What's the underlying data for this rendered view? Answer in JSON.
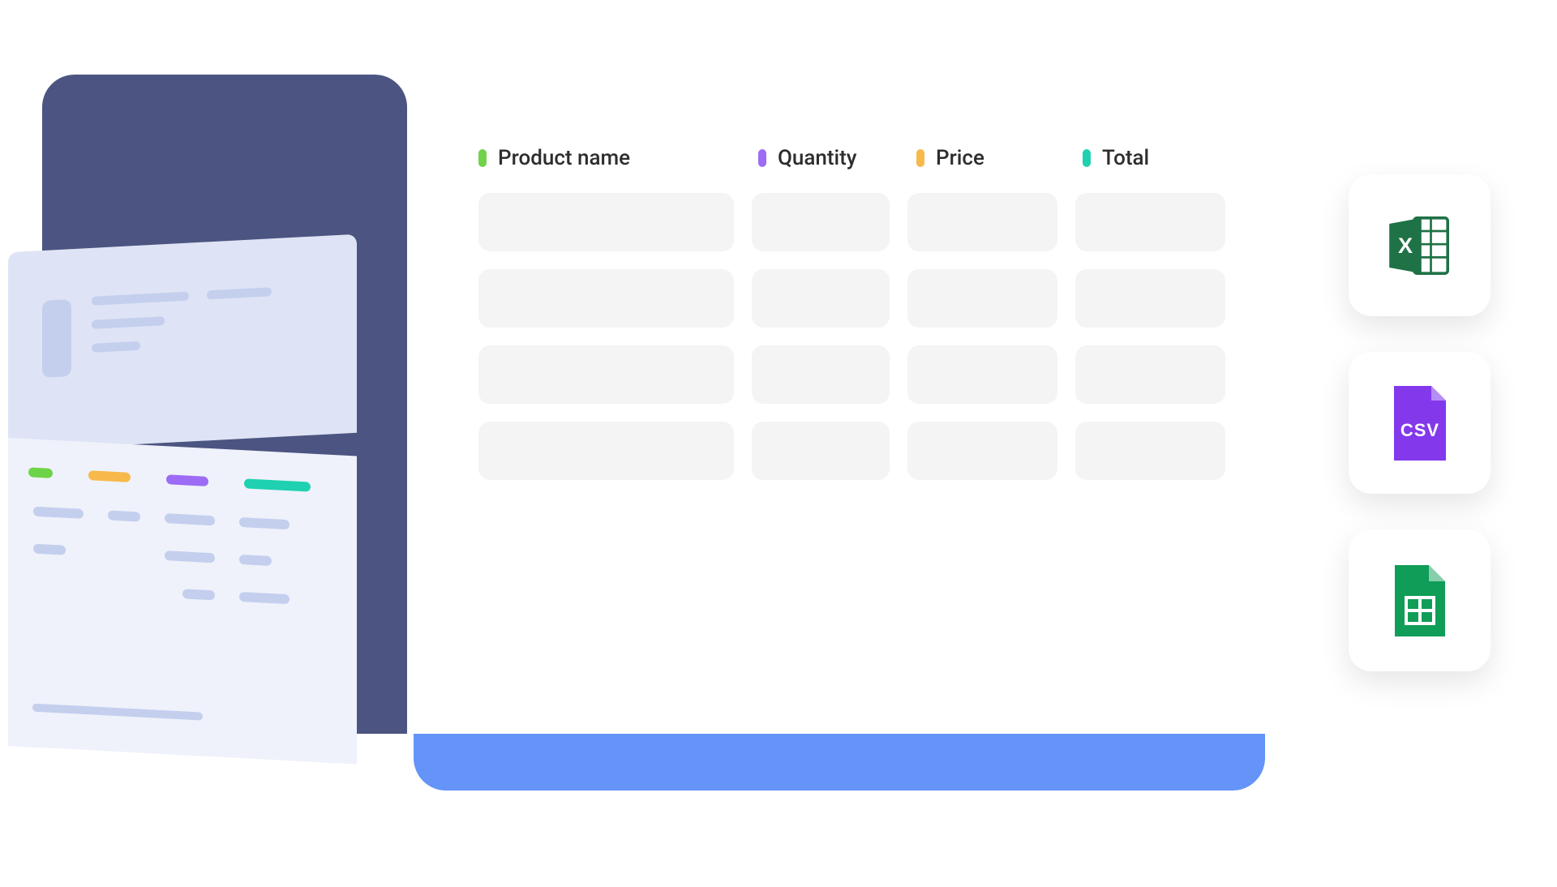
{
  "table": {
    "columns": [
      {
        "label": "Product name",
        "color": "green"
      },
      {
        "label": "Quantity",
        "color": "purple"
      },
      {
        "label": "Price",
        "color": "yellow"
      },
      {
        "label": "Total",
        "color": "teal"
      }
    ],
    "row_count": 4
  },
  "export_options": [
    {
      "name": "excel",
      "label": "Excel"
    },
    {
      "name": "csv",
      "label": "CSV"
    },
    {
      "name": "sheets",
      "label": "Google Sheets"
    }
  ],
  "colors": {
    "bg_dark": "#4c5481",
    "blue_bar": "#6494f7",
    "paper_top": "#dee4f5",
    "paper_bot": "#eff2fb",
    "placeholder": "#c4cfee",
    "cell": "#f4f4f5",
    "green": "#6fd349",
    "purple": "#9c6cf4",
    "yellow": "#f7b94b",
    "teal": "#1fd1b0",
    "excel_green": "#1f7246",
    "csv_purple": "#8338ec",
    "sheets_green": "#0f9d58"
  }
}
